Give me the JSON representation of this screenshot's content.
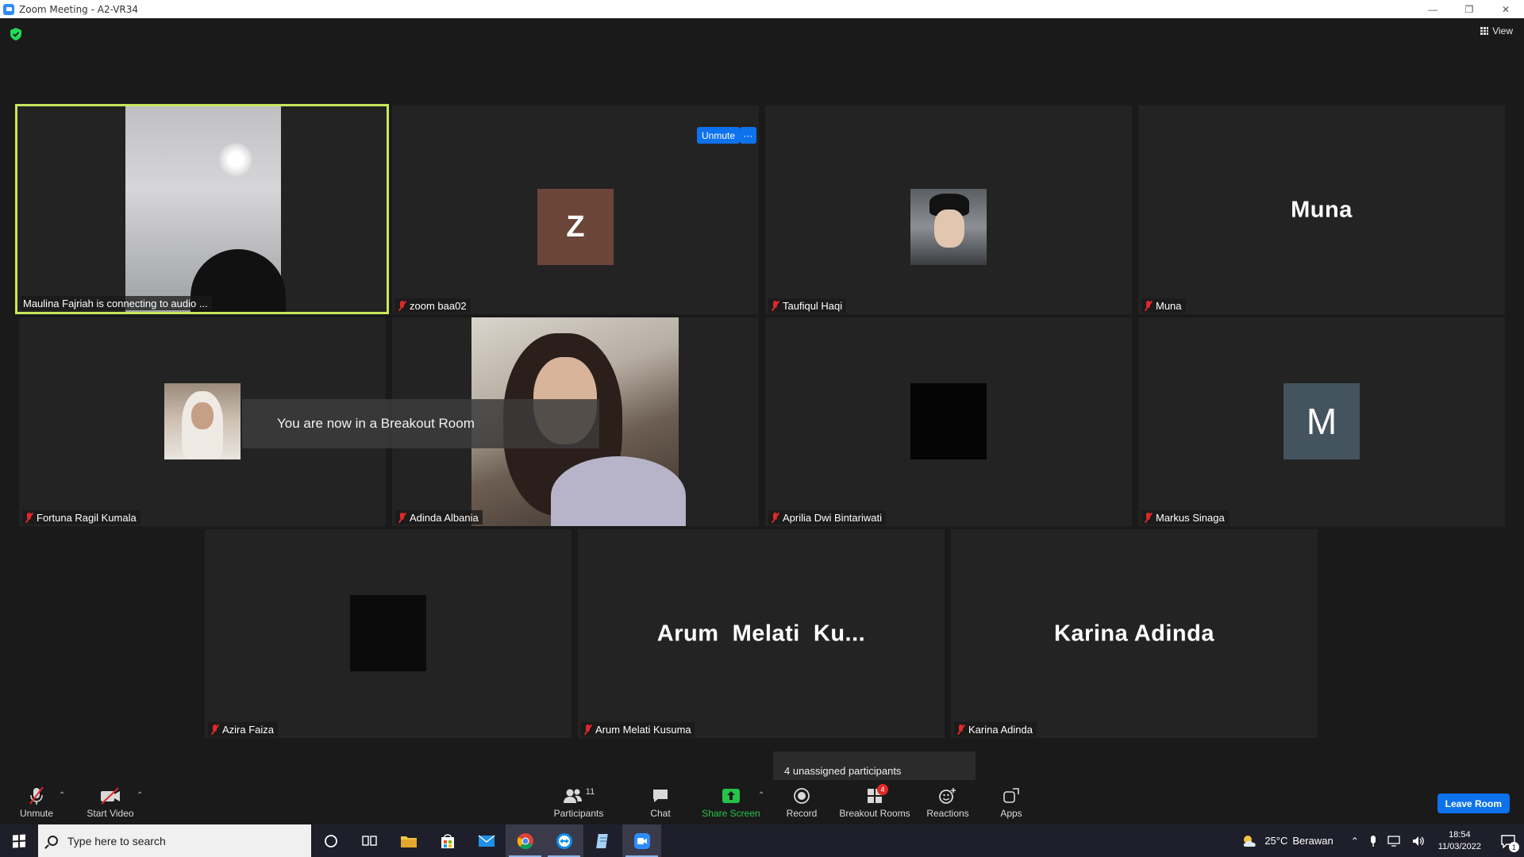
{
  "window": {
    "title": "Zoom Meeting - A2-VR34"
  },
  "meeting": {
    "view_label": "View"
  },
  "tiles": [
    {
      "name": "Maulina Fajriah is connecting to audio ..."
    },
    {
      "name": "zoom baa02",
      "letter": "Z"
    },
    {
      "name": "Taufiqul Haqi"
    },
    {
      "name": "Muna",
      "big_name": "Muna"
    },
    {
      "name": "Fortuna Ragil Kumala"
    },
    {
      "name": "Adinda Albania"
    },
    {
      "name": "Aprilia Dwi Bintariwati"
    },
    {
      "name": "Markus Sinaga",
      "letter": "M"
    },
    {
      "name": "Azira Faiza"
    },
    {
      "name": "Arum Melati Kusuma",
      "big_name": "Arum  Melati  Ku..."
    },
    {
      "name": "Karina Adinda",
      "big_name": "Karina Adinda"
    }
  ],
  "hover_controls": {
    "unmute_label": "Unmute",
    "more_label": "···"
  },
  "notice": {
    "breakout_message": "You are now in a Breakout Room"
  },
  "tooltip": {
    "unassigned": "4 unassigned participants"
  },
  "toolbar": {
    "unmute": "Unmute",
    "start_video": "Start Video",
    "participants": "Participants",
    "participants_count": "11",
    "chat": "Chat",
    "share_screen": "Share Screen",
    "record": "Record",
    "breakout_rooms": "Breakout Rooms",
    "breakout_badge": "4",
    "reactions": "Reactions",
    "apps": "Apps",
    "leave_room": "Leave Room"
  },
  "taskbar": {
    "search_placeholder": "Type here to search",
    "weather_temp": "25°C",
    "weather_desc": "Berawan",
    "time": "18:54",
    "date": "11/03/2022",
    "notification_count": "1"
  },
  "colors": {
    "accent": "#0e72ed",
    "active_speaker": "#c8e85a",
    "muted": "#e02828",
    "share_green": "#27c24c"
  }
}
